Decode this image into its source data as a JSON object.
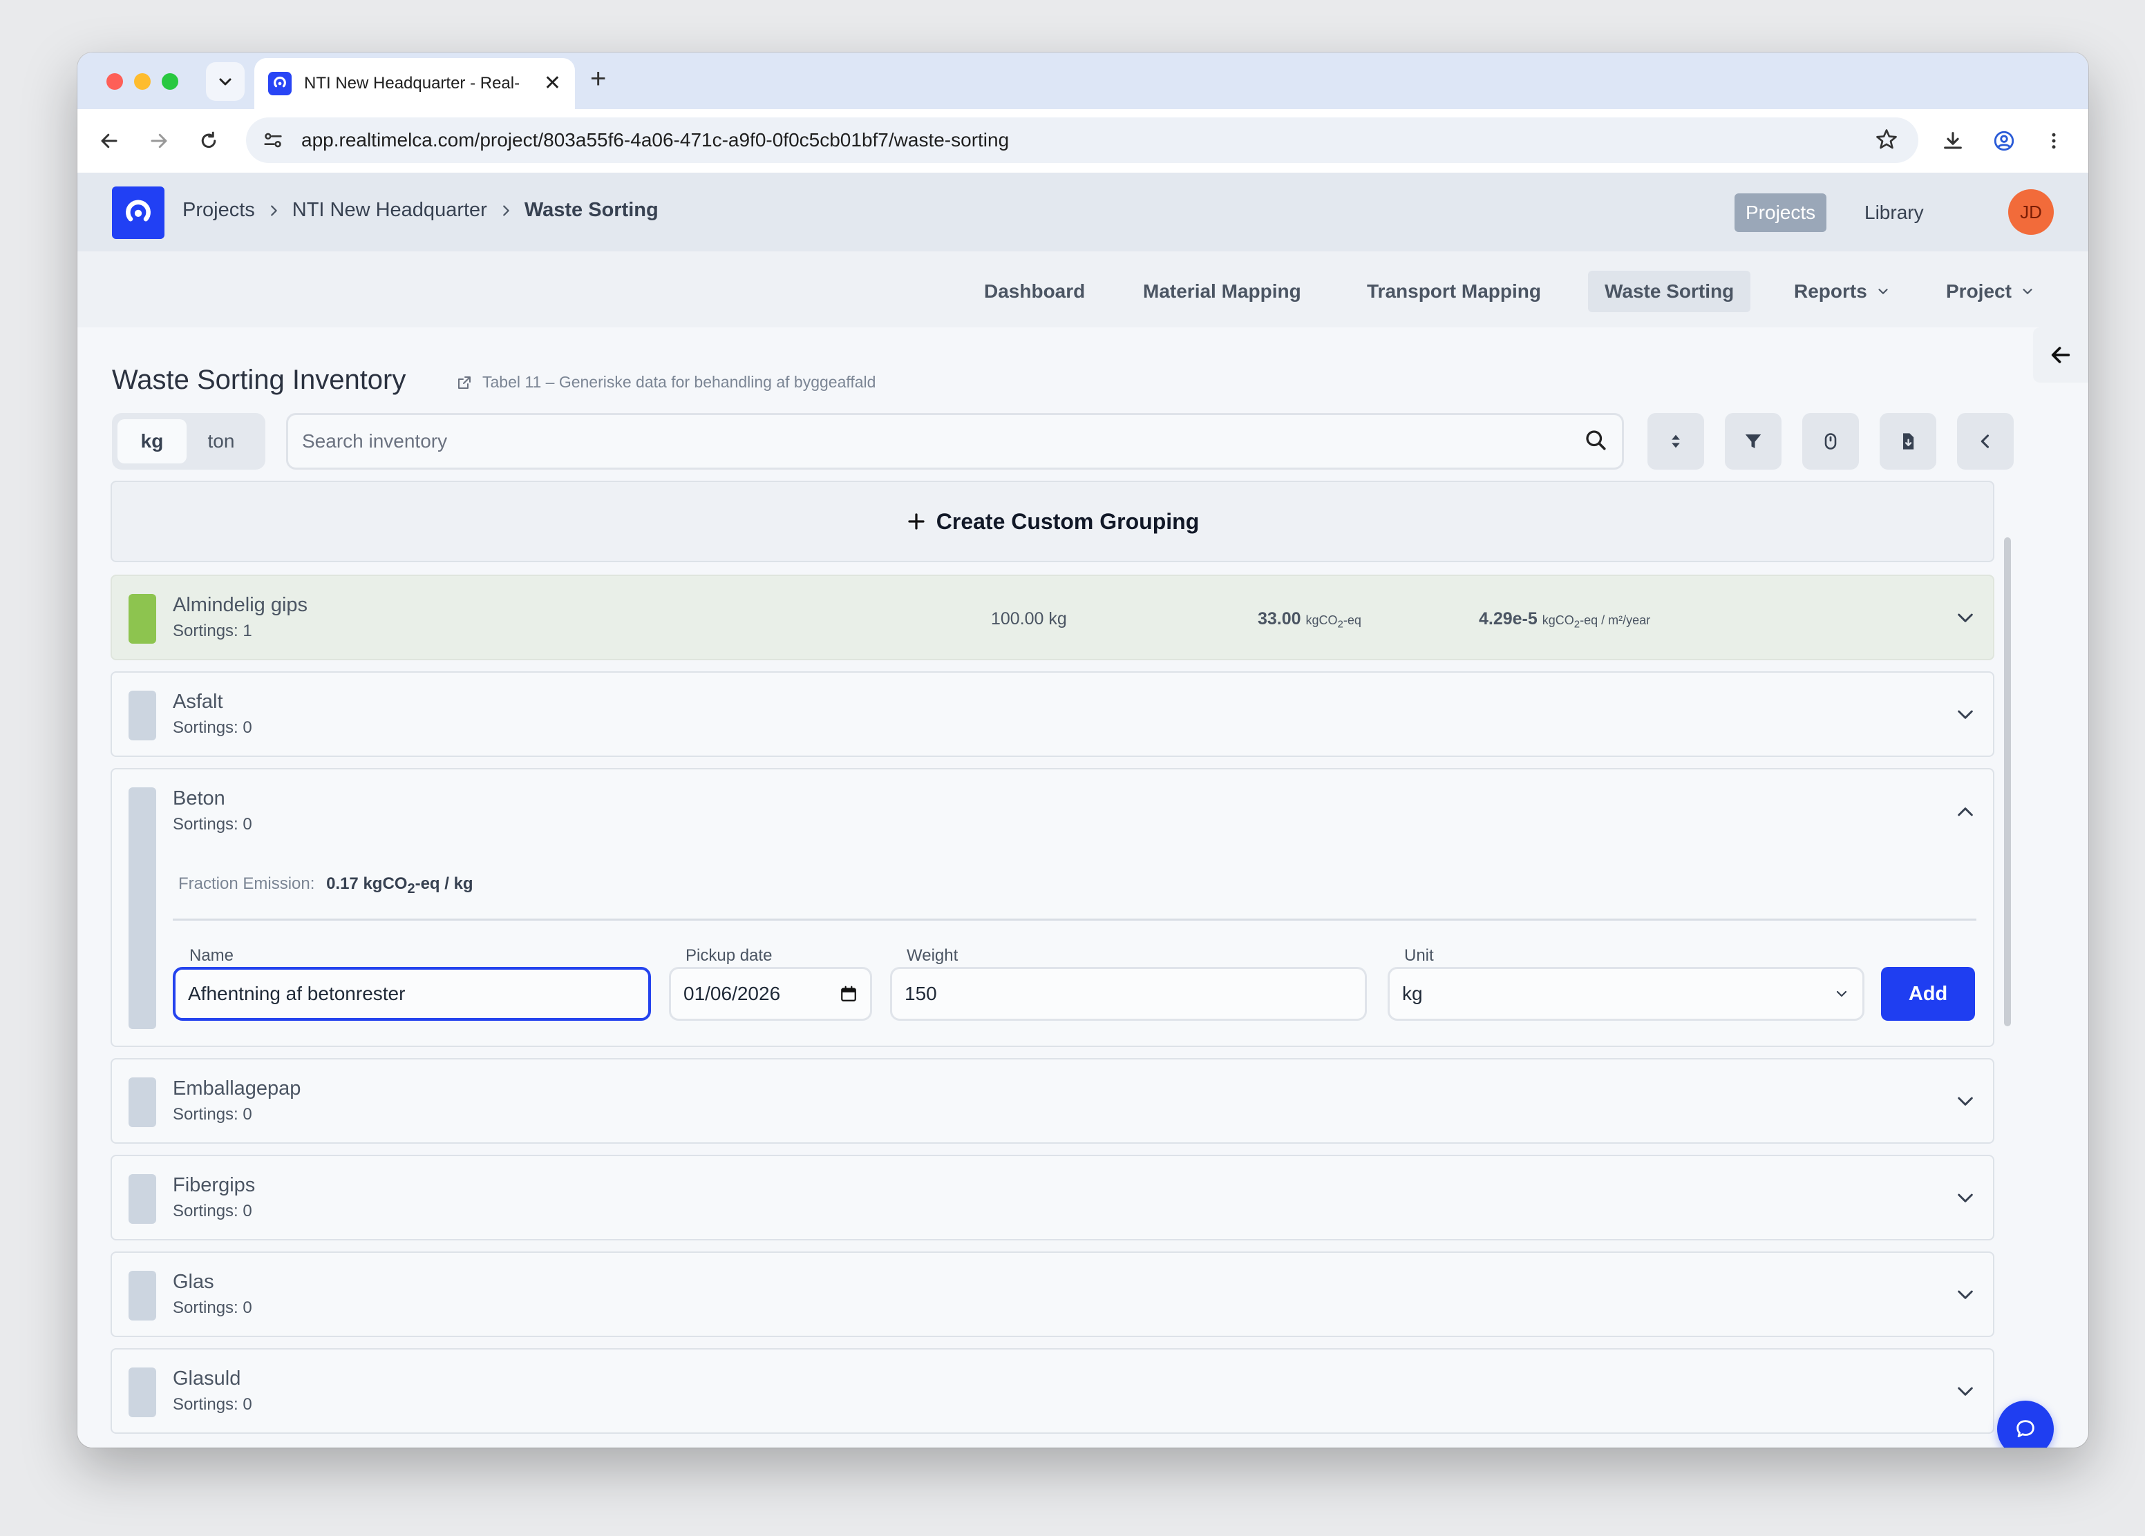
{
  "browser": {
    "tab_title": "NTI New Headquarter - Real-",
    "url": "app.realtimelca.com/project/803a55f6-4a06-471c-a9f0-0f0c5cb01bf7/waste-sorting"
  },
  "header": {
    "breadcrumb": [
      "Projects",
      "NTI New Headquarter",
      "Waste Sorting"
    ],
    "projects_label": "Projects",
    "library_label": "Library",
    "avatar_initials": "JD"
  },
  "nav": {
    "dashboard": "Dashboard",
    "material_mapping": "Material Mapping",
    "transport_mapping": "Transport Mapping",
    "waste_sorting": "Waste Sorting",
    "reports": "Reports",
    "project": "Project"
  },
  "page": {
    "title": "Waste Sorting Inventory",
    "source_link": "Tabel 11 – Generiske data for behandling af byggeaffald",
    "unit_options": [
      "kg",
      "ton"
    ],
    "selected_unit": "kg",
    "search_placeholder": "Search inventory",
    "create_grouping": "Create Custom Grouping"
  },
  "rows": [
    {
      "name": "Almindelig gips",
      "sortings": "Sortings: 1",
      "weight": "100.00 kg",
      "emission_value": "33.00",
      "emission_unit_pre": "kgCO",
      "emission_unit_sub": "2",
      "emission_unit_post": "-eq",
      "intensity_value": "4.29e-5",
      "intensity_unit_pre": "kgCO",
      "intensity_unit_sub": "2",
      "intensity_unit_post": "-eq / m²/year"
    },
    {
      "name": "Asfalt",
      "sortings": "Sortings: 0"
    },
    {
      "name": "Beton",
      "sortings": "Sortings: 0"
    },
    {
      "name": "Emballagepap",
      "sortings": "Sortings: 0"
    },
    {
      "name": "Fibergips",
      "sortings": "Sortings: 0"
    },
    {
      "name": "Glas",
      "sortings": "Sortings: 0"
    },
    {
      "name": "Glasuld",
      "sortings": "Sortings: 0"
    }
  ],
  "expanded_form": {
    "fraction_label": "Fraction Emission:",
    "fraction_value_pre": "0.17 kgCO",
    "fraction_value_sub": "2",
    "fraction_value_post": "-eq / kg",
    "name_label": "Name",
    "name_value": "Afhentning af betonrester",
    "pickup_label": "Pickup date",
    "pickup_value": "01/06/2026",
    "weight_label": "Weight",
    "weight_value": "150",
    "unit_label": "Unit",
    "unit_value": "kg",
    "add_label": "Add"
  },
  "colors": {
    "accent": "#1f3ef1",
    "gips_swatch": "#8dc44f",
    "neutral_swatch": "#ccd5e0"
  }
}
